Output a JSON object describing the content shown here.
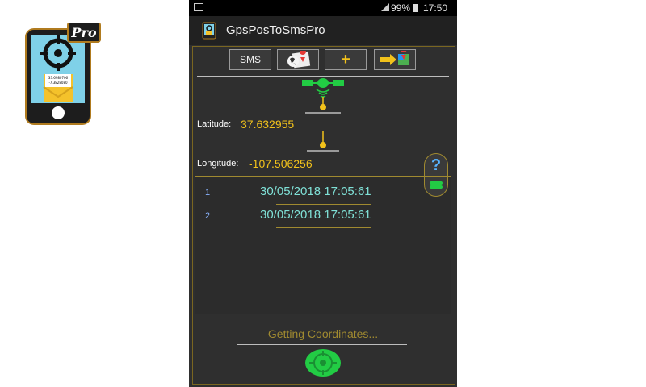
{
  "statusbar": {
    "battery": "99%",
    "time": "17:50"
  },
  "app": {
    "title": "GpsPosToSmsPro"
  },
  "app_icon": {
    "badge": "Pro",
    "sms_preview_line1": "33.6980706",
    "sms_preview_line2": "-7.3828080"
  },
  "toolbar": {
    "sms_label": "SMS",
    "map_pin_icon": "world-map-pin-icon",
    "add_label": "+",
    "share_maps_icon": "arrow-maps-icon"
  },
  "coords": {
    "latitude_label": "Latitude:",
    "latitude_value": "37.632955",
    "longitude_label": "Longitude:",
    "longitude_value": "-107.506256"
  },
  "help_label": "?",
  "history": [
    {
      "index": "1",
      "datetime": "30/05/2018 17:05:61"
    },
    {
      "index": "2",
      "datetime": "30/05/2018 17:05:61"
    }
  ],
  "status": {
    "text": "Getting Coordinates..."
  },
  "colors": {
    "accent_gold": "#f2c21b",
    "frame": "#a08a30",
    "list_text": "#7fe0d6",
    "gps_green": "#22cc44"
  }
}
